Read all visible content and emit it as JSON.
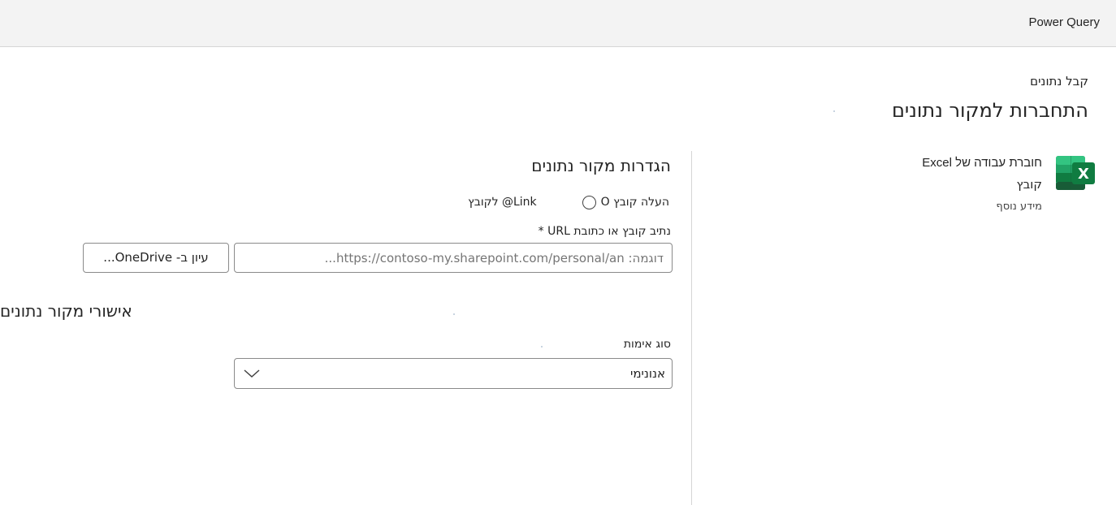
{
  "app": {
    "name": "Power Query"
  },
  "header": {
    "breadcrumb": "קבל נתונים",
    "title": "התחברות למקור נתונים"
  },
  "connector": {
    "name": "חוברת עבודה של Excel",
    "type": "קובץ",
    "learn_more": "מידע נוסף",
    "icon": "excel-icon",
    "icon_color": "#107c41"
  },
  "settings": {
    "title": "הגדרות מקור נתונים",
    "radio_link": "Link@ לקובץ",
    "radio_upload": "העלה קובץ O",
    "url_label": "נתיב קובץ או כתובת URL *",
    "url_placeholder": "דוגמה: https://contoso-my.sharepoint.com/personal/an...",
    "browse_label": "עיון ב- OneDrive..."
  },
  "credentials": {
    "title": "אישורי מקור נתונים",
    "auth_label": "סוג אימות",
    "auth_value": "אנונימי"
  }
}
